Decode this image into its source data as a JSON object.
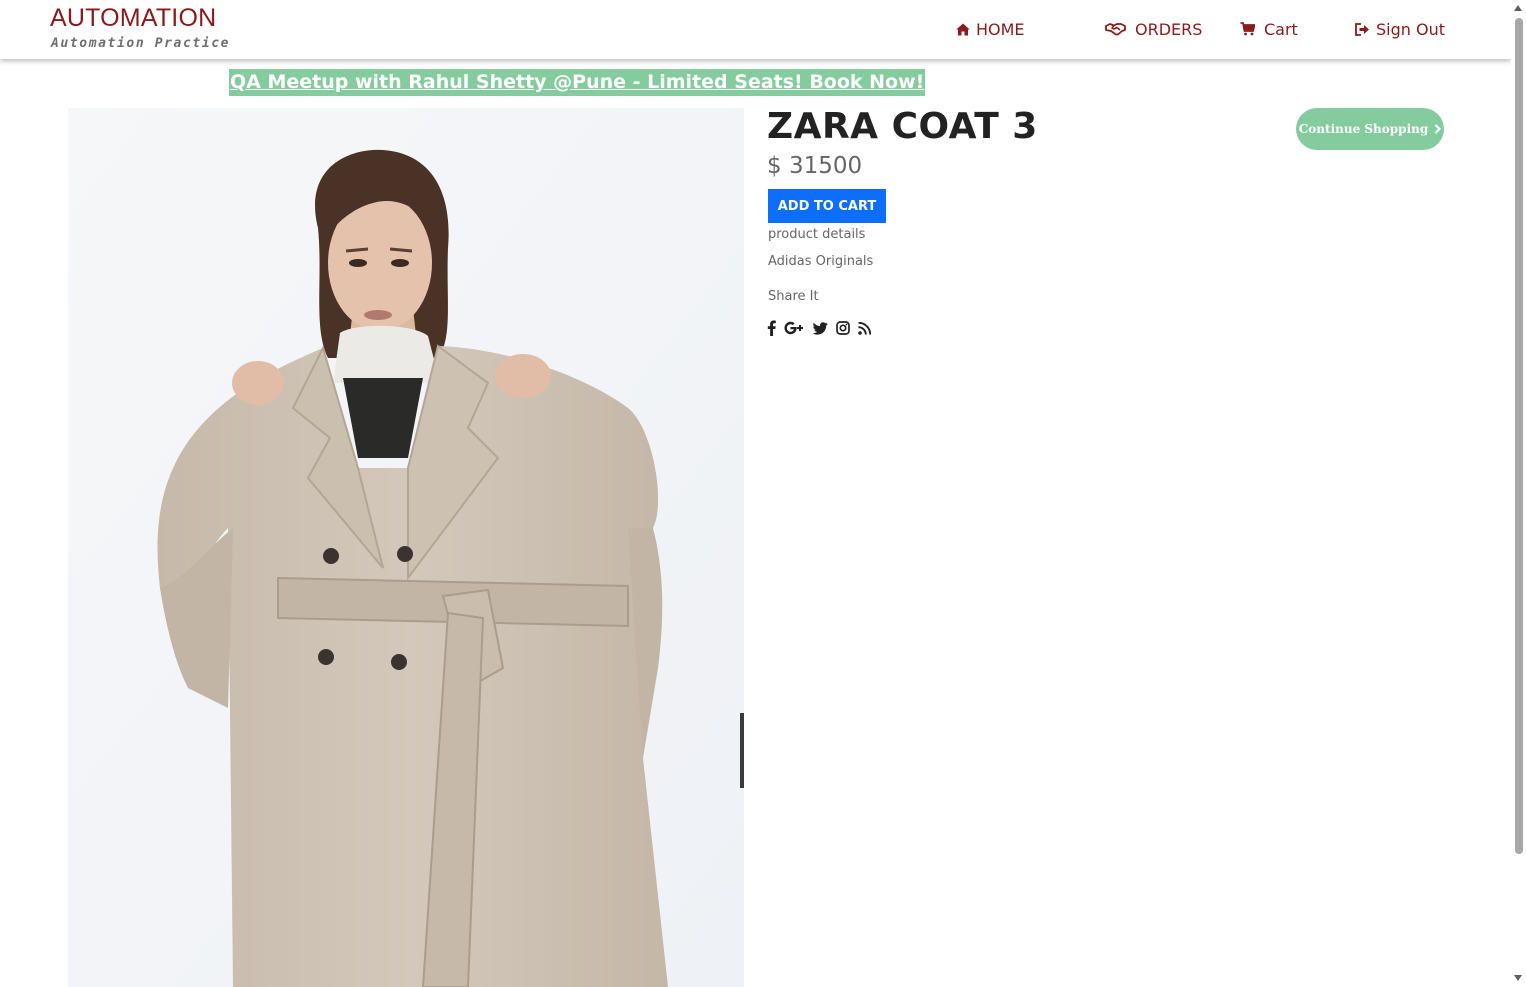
{
  "brand": {
    "title": "AUTOMATION",
    "subtitle": "Automation Practice"
  },
  "nav": {
    "home": "HOME",
    "orders": "ORDERS",
    "cart": "Cart",
    "sign_out": "Sign Out"
  },
  "promo": {
    "text": "QA Meetup with Rahul Shetty @Pune - Limited Seats! Book Now!"
  },
  "product": {
    "name": "ZARA COAT 3",
    "price": "$ 31500",
    "add_to_cart_label": "ADD TO CART",
    "details_label": "product details",
    "brand": "Adidas Originals",
    "image_icon": "product-photo-coat-model"
  },
  "share": {
    "label": "Share It",
    "icons": [
      "facebook-icon",
      "google-plus-icon",
      "twitter-icon",
      "instagram-icon",
      "rss-icon"
    ]
  },
  "continue_shopping": {
    "label": "Continue Shopping"
  },
  "colors": {
    "brand": "#8b1a1a",
    "accent_green": "#84cc9d",
    "primary_button": "#0d6efd",
    "text_dark": "#222222",
    "text_muted": "#666666"
  }
}
